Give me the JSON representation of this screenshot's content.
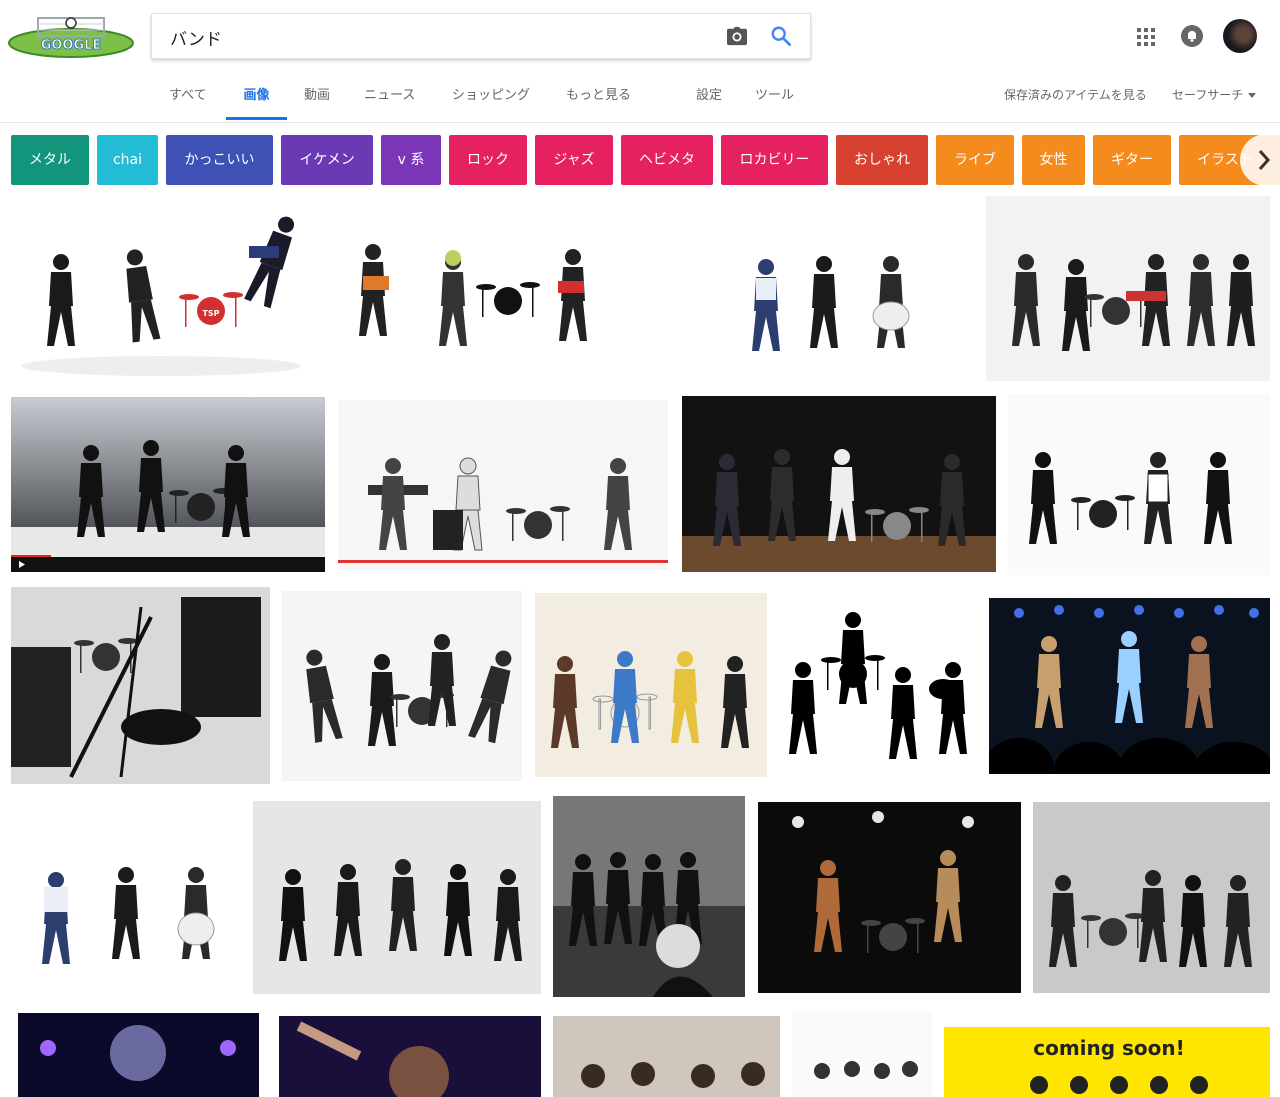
{
  "logo": {
    "text": "GOOGLE"
  },
  "search": {
    "query": "バンド"
  },
  "tabs": {
    "all": "すべて",
    "images": "画像",
    "videos": "動画",
    "news": "ニュース",
    "shopping": "ショッピング",
    "more": "もっと見る",
    "settings": "設定",
    "tools": "ツール",
    "saved": "保存済みのアイテムを見る",
    "safesearch": "セーフサーチ"
  },
  "chips": [
    {
      "label": "メタル",
      "color": "#13957b"
    },
    {
      "label": "chai",
      "color": "#22bcd4"
    },
    {
      "label": "かっこいい",
      "color": "#3f51b5"
    },
    {
      "label": "イケメン",
      "color": "#6a3ab5"
    },
    {
      "label": "v 系",
      "color": "#7b36b8"
    },
    {
      "label": "ロック",
      "color": "#e6215f"
    },
    {
      "label": "ジャズ",
      "color": "#e6215f"
    },
    {
      "label": "ヘビメタ",
      "color": "#e6215f"
    },
    {
      "label": "ロカビリー",
      "color": "#e6215f"
    },
    {
      "label": "おしゃれ",
      "color": "#d8402f"
    },
    {
      "label": "ライブ",
      "color": "#f58b1c"
    },
    {
      "label": "女性",
      "color": "#f58b1c"
    },
    {
      "label": "ギター",
      "color": "#f58b1c"
    },
    {
      "label": "イラスト",
      "color": "#f58b1c"
    }
  ],
  "images": {
    "coming_soon_text": "coming soon!",
    "amp_text": "TSP"
  }
}
